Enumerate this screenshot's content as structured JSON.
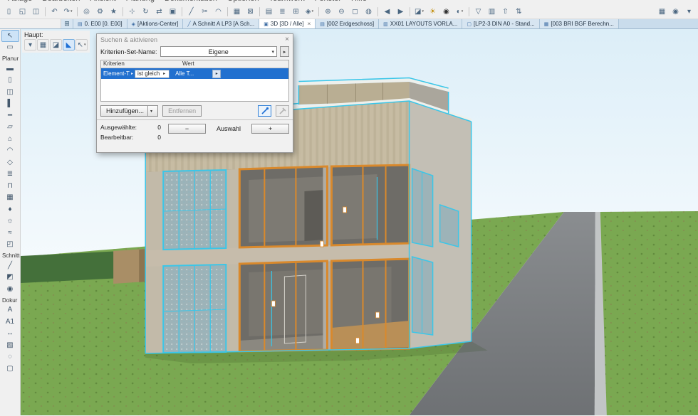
{
  "menubar": {
    "items": [
      "Ablage",
      "Bearbeiten",
      "Ansicht",
      "Planung",
      "Dokumentation",
      "Optionen",
      "Teamwork",
      "Fenster",
      "Hilfe"
    ]
  },
  "toolbar": {
    "items": [
      {
        "name": "new-file-icon",
        "glyph": "▯"
      },
      {
        "name": "open-file-icon",
        "glyph": "◱"
      },
      {
        "name": "save-icon",
        "glyph": "◫"
      },
      {
        "type": "sep"
      },
      {
        "name": "undo-icon",
        "glyph": "↶"
      },
      {
        "name": "redo-icon",
        "glyph": "↷",
        "caret": true
      },
      {
        "type": "sep"
      },
      {
        "name": "find-select-icon",
        "glyph": "◎"
      },
      {
        "name": "element-settings-icon",
        "glyph": "⚙"
      },
      {
        "name": "favorites-icon",
        "glyph": "★"
      },
      {
        "type": "sep"
      },
      {
        "name": "move-icon",
        "glyph": "⊹"
      },
      {
        "name": "rotate-icon",
        "glyph": "↻"
      },
      {
        "name": "mirror-icon",
        "glyph": "⇄"
      },
      {
        "name": "multiply-icon",
        "glyph": "▣"
      },
      {
        "type": "sep"
      },
      {
        "name": "split-icon",
        "glyph": "╱"
      },
      {
        "name": "trim-icon",
        "glyph": "✂"
      },
      {
        "name": "fillet-icon",
        "glyph": "◠"
      },
      {
        "type": "sep"
      },
      {
        "name": "group-icon",
        "glyph": "▦"
      },
      {
        "name": "lock-icon",
        "glyph": "⊠"
      },
      {
        "type": "sep"
      },
      {
        "name": "layers-icon",
        "glyph": "▤"
      },
      {
        "name": "stories-icon",
        "glyph": "≣"
      },
      {
        "name": "grid-icon",
        "glyph": "⊞"
      },
      {
        "name": "snap-icon",
        "glyph": "◈",
        "caret": true
      },
      {
        "type": "sep"
      },
      {
        "name": "zoom-in-icon",
        "glyph": "⊕"
      },
      {
        "name": "zoom-out-icon",
        "glyph": "⊖"
      },
      {
        "name": "fit-view-icon",
        "glyph": "◻"
      },
      {
        "name": "orbit-icon",
        "glyph": "◍"
      },
      {
        "type": "sep"
      },
      {
        "name": "previous-view-icon",
        "glyph": "◀"
      },
      {
        "name": "next-view-icon",
        "glyph": "▶"
      },
      {
        "type": "sep"
      },
      {
        "name": "3d-style-icon",
        "glyph": "◪",
        "caret": true
      },
      {
        "name": "sun-study-icon",
        "glyph": "☀",
        "color": "#c08a00"
      },
      {
        "name": "camera-icon",
        "glyph": "◉",
        "color": "#333333"
      },
      {
        "name": "render-icon",
        "glyph": "◐",
        "caret": true
      },
      {
        "type": "sep"
      },
      {
        "name": "marquee-view-icon",
        "glyph": "▽"
      },
      {
        "name": "layout-book-icon",
        "glyph": "▥"
      },
      {
        "name": "publish-icon",
        "glyph": "⇧"
      },
      {
        "name": "teamwork-sync-icon",
        "glyph": "⇅"
      }
    ],
    "right_items": [
      {
        "name": "quick-options-icon",
        "glyph": "▦"
      },
      {
        "name": "camera-settings-icon",
        "glyph": "◉"
      },
      {
        "name": "more-toolbars-icon",
        "glyph": "▾"
      }
    ]
  },
  "tabbar": {
    "overview_glyph": "⊞",
    "tabs": [
      {
        "name": "tab-e00",
        "icon": "▤",
        "label": "0. E00 [0. E00]"
      },
      {
        "name": "tab-aktions-center",
        "icon": "◈",
        "label": "[Aktions-Center]"
      },
      {
        "name": "tab-schnitt",
        "icon": "╱",
        "label": "A Schnitt A LP3 [A Sch..."
      },
      {
        "name": "tab-3d",
        "icon": "▣",
        "label": "3D [3D / Alle]",
        "active": true,
        "close": "×"
      },
      {
        "name": "tab-erdgeschoss",
        "icon": "▤",
        "label": "[002 Erdgeschoss]"
      },
      {
        "name": "tab-layouts",
        "icon": "▥",
        "label": "XX01 LAYOUTS VORLA..."
      },
      {
        "name": "tab-din-a0",
        "icon": "▢",
        "label": "[LP2-3 DIN A0 - Stand..."
      },
      {
        "name": "tab-bgf",
        "icon": "▦",
        "label": "[003 BRI BGF Berechn..."
      }
    ]
  },
  "haupt": {
    "label": "Haupt:",
    "buttons": [
      {
        "name": "options-caret-icon",
        "glyph": "▾"
      },
      {
        "name": "grid-pen-icon",
        "glyph": "▦"
      },
      {
        "name": "eraser-icon",
        "glyph": "◪"
      },
      {
        "name": "trowel-icon",
        "glyph": "◣",
        "active": true
      },
      {
        "name": "arrow-cursor-icon",
        "glyph": "↖",
        "caret": true
      }
    ]
  },
  "toolbox": {
    "items": [
      {
        "type": "tool",
        "name": "arrow-tool",
        "text": "↖",
        "selected": true
      },
      {
        "type": "tool",
        "name": "marquee-tool",
        "text": "▭"
      },
      {
        "type": "label",
        "name": "toolbox-group-planung",
        "text": "Planur"
      },
      {
        "type": "tool",
        "name": "wall-tool",
        "text": "▬"
      },
      {
        "type": "tool",
        "name": "door-tool",
        "text": "▯"
      },
      {
        "type": "tool",
        "name": "window-tool",
        "text": "◫"
      },
      {
        "type": "tool",
        "name": "column-tool",
        "text": "▌"
      },
      {
        "type": "tool",
        "name": "beam-tool",
        "text": "━"
      },
      {
        "type": "tool",
        "name": "slab-tool",
        "text": "▱"
      },
      {
        "type": "tool",
        "name": "roof-tool",
        "text": "⌂"
      },
      {
        "type": "tool",
        "name": "shell-tool",
        "text": "◠"
      },
      {
        "type": "tool",
        "name": "morph-tool",
        "text": "◇"
      },
      {
        "type": "tool",
        "name": "stair-tool",
        "text": "≣"
      },
      {
        "type": "tool",
        "name": "railing-tool",
        "text": "⊓"
      },
      {
        "type": "tool",
        "name": "curtain-wall-tool",
        "text": "▦"
      },
      {
        "type": "tool",
        "name": "object-tool",
        "text": "♦"
      },
      {
        "type": "tool",
        "name": "lamp-tool",
        "text": "☼"
      },
      {
        "type": "tool",
        "name": "mesh-tool",
        "text": "≈"
      },
      {
        "type": "tool",
        "name": "zone-tool",
        "text": "◰"
      },
      {
        "type": "label",
        "name": "toolbox-group-schnitte",
        "text": "Schnitte"
      },
      {
        "type": "tool",
        "name": "section-tool",
        "text": "╱"
      },
      {
        "type": "tool",
        "name": "elevation-tool",
        "text": "◩"
      },
      {
        "type": "tool",
        "name": "camera-tool",
        "text": "◉"
      },
      {
        "type": "label",
        "name": "toolbox-group-dokumentation",
        "text": "Dokur"
      },
      {
        "type": "tool",
        "name": "text-tool",
        "text": "A"
      },
      {
        "type": "tool",
        "name": "label-tool",
        "text": "A1"
      },
      {
        "type": "tool",
        "name": "dimension-tool",
        "text": "↔"
      },
      {
        "type": "tool",
        "name": "fill-tool",
        "text": "▨"
      },
      {
        "type": "tool",
        "name": "detail-tool",
        "text": "◌"
      },
      {
        "type": "tool",
        "name": "worksheet-tool",
        "text": "▢"
      }
    ]
  },
  "dialog": {
    "title": "Suchen & aktivieren",
    "close_glyph": "×",
    "criteria_set_label": "Kriterien-Set-Name:",
    "criteria_set_value": "Eigene",
    "flyout_glyph": "▸",
    "columns": {
      "criteria": "Kriterien",
      "value": "Wert"
    },
    "row": {
      "criterion": "Element-T...",
      "operator": "ist gleich",
      "value": "Alle T..."
    },
    "add_button": "Hinzufügen...",
    "remove_button": "Entfernen",
    "selected_label": "Ausgewählte:",
    "selected_value": "0",
    "editable_label": "Bearbeitbar:",
    "editable_value": "0",
    "minus_label": "−",
    "selection_label": "Auswahl",
    "plus_label": "+"
  },
  "scene": {
    "colors": {
      "sky-top": "#dceef8",
      "sky-bottom": "#ffffff",
      "grass": "#7aa851",
      "grass-dark": "#587f36",
      "hedge": "#44703a",
      "wall-block": "#a98e66",
      "road": "#8a8d90",
      "road-dark": "#6e7174",
      "curb": "#c2c5c6",
      "wood": "#c7bca3",
      "wood-dark": "#b1a78d",
      "concrete": "#c2baa9",
      "concrete-side": "#c3bfb5",
      "interior": "#6e6c67",
      "floor-band": "#c6bcab",
      "wood-floor": "#b98f57",
      "glass": "#9db3b8",
      "column": "#b0aca3",
      "roof": "#eef0ec",
      "selection": "#3bc6e8",
      "highlight": "#d9892c"
    }
  }
}
